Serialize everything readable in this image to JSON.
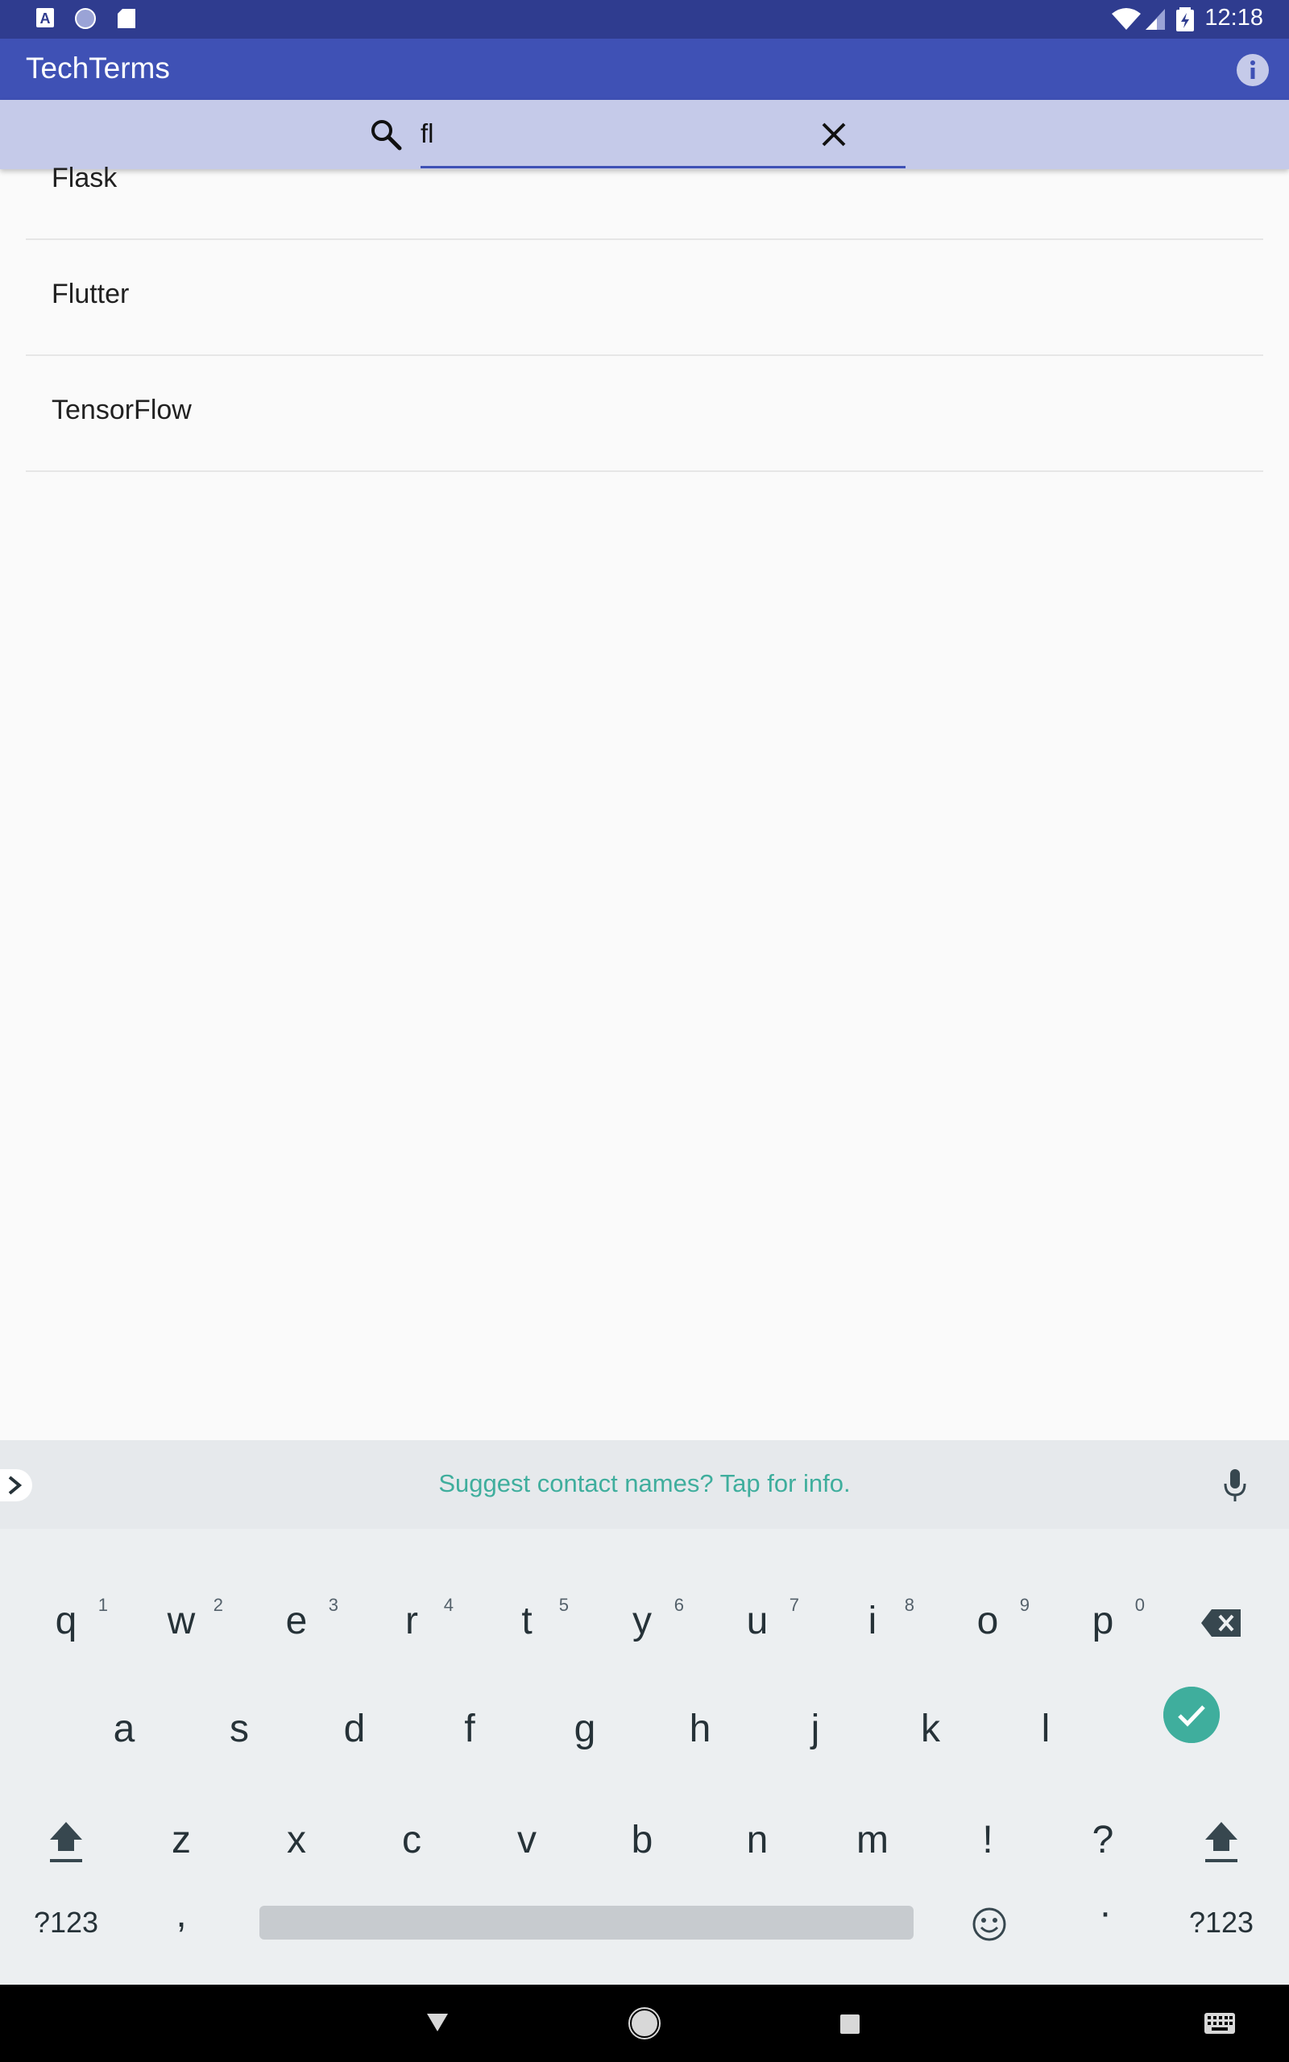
{
  "status_bar": {
    "time": "12:18"
  },
  "app_bar": {
    "title": "TechTerms"
  },
  "search": {
    "value": "fl"
  },
  "results": [
    {
      "label": "Flask"
    },
    {
      "label": "Flutter"
    },
    {
      "label": "TensorFlow"
    }
  ],
  "keyboard": {
    "suggestion": "Suggest contact names? Tap for info.",
    "row1": [
      {
        "key": "q",
        "hint": "1"
      },
      {
        "key": "w",
        "hint": "2"
      },
      {
        "key": "e",
        "hint": "3"
      },
      {
        "key": "r",
        "hint": "4"
      },
      {
        "key": "t",
        "hint": "5"
      },
      {
        "key": "y",
        "hint": "6"
      },
      {
        "key": "u",
        "hint": "7"
      },
      {
        "key": "i",
        "hint": "8"
      },
      {
        "key": "o",
        "hint": "9"
      },
      {
        "key": "p",
        "hint": "0"
      }
    ],
    "row2": [
      "a",
      "s",
      "d",
      "f",
      "g",
      "h",
      "j",
      "k",
      "l"
    ],
    "row3": [
      "z",
      "x",
      "c",
      "v",
      "b",
      "n",
      "m",
      "!",
      "?"
    ],
    "symbols_label": "?123",
    "comma": ",",
    "period": "·"
  },
  "colors": {
    "status_bar": "#2f3c8f",
    "app_bar": "#3f51b5",
    "search_bar": "#c5cae9",
    "accent": "#3fae9d"
  }
}
